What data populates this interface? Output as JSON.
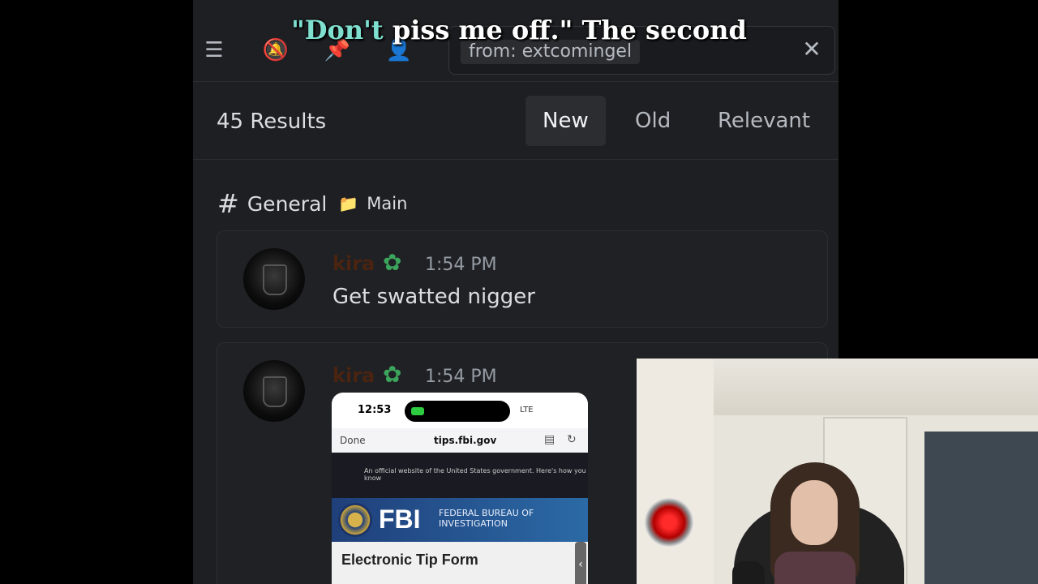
{
  "caption": {
    "highlight": "\"Don't",
    "rest": " piss me off.\" The second"
  },
  "search": {
    "filter_chip": "from: extcomingel",
    "icons": [
      "threads-icon",
      "notifications-muted-icon",
      "pin-icon",
      "members-icon"
    ]
  },
  "results": {
    "count_label": "45 Results",
    "sort_tabs": [
      "New",
      "Old",
      "Relevant"
    ],
    "active_tab": "New"
  },
  "channel": {
    "name": "General",
    "category": "Main"
  },
  "messages": [
    {
      "author": "kira",
      "time": "1:54 PM",
      "content": "Get swatted nigger"
    },
    {
      "author": "kira",
      "time": "1:54 PM",
      "content": ""
    }
  ],
  "attachment": {
    "time": "12:53",
    "network": "LTE",
    "done_label": "Done",
    "url": "tips.fbi.gov",
    "gov_banner": "An official website of the United States government. Here's how you know",
    "fbi_letters": "FBI",
    "fbi_subtitle": "FEDERAL BUREAU OF INVESTIGATION",
    "form_title": "Electronic Tip Form"
  },
  "colors": {
    "accent_badge": "#3ba55c",
    "author_name": "#4a2410",
    "fbi_blue": "#2b6aa6"
  }
}
